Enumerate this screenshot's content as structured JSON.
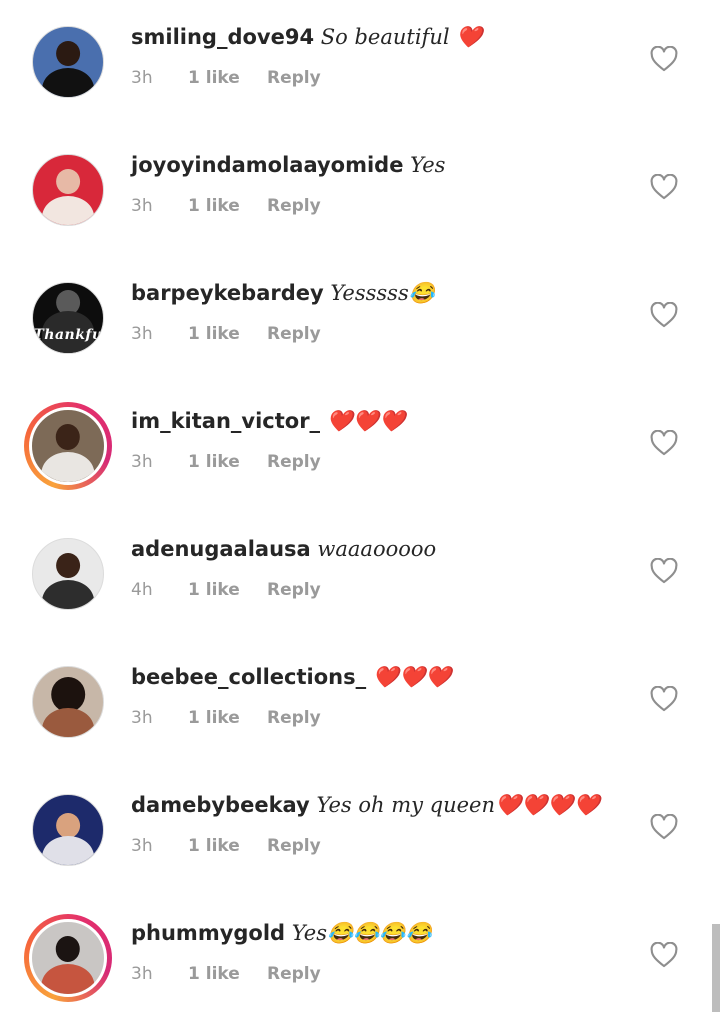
{
  "comments": [
    {
      "username": "smiling_dove94",
      "text": "So beautiful ❤️",
      "time": "3h",
      "likes": "1 like",
      "reply": "Reply",
      "avatar": {
        "bg": "#4a6fae",
        "head": "#2b1a12",
        "body": "#111111",
        "ring": false
      }
    },
    {
      "username": "joyoyindamolaayomide",
      "text": "Yes",
      "time": "3h",
      "likes": "1 like",
      "reply": "Reply",
      "avatar": {
        "bg": "#d8283a",
        "head": "#e7b9a6",
        "body": "#f2e6e0",
        "ring": false
      }
    },
    {
      "username": "barpeykebardey",
      "text": "Yesssss😂",
      "time": "3h",
      "likes": "1 like",
      "reply": "Reply",
      "avatar": {
        "bg": "#0d0d0d",
        "head": "#5a5a5a",
        "body": "#2a2a2a",
        "ring": false,
        "badge": "Thankfu"
      }
    },
    {
      "username": "im_kitan_victor_",
      "text": "❤️❤️❤️",
      "time": "3h",
      "likes": "1 like",
      "reply": "Reply",
      "avatar": {
        "bg": "#7d6a57",
        "head": "#3b2418",
        "body": "#e9e6e2",
        "ring": true
      }
    },
    {
      "username": "adenugaalausa",
      "text": "waaaooooo",
      "time": "4h",
      "likes": "1 like",
      "reply": "Reply",
      "avatar": {
        "bg": "#e9e9e9",
        "head": "#3a2318",
        "body": "#2d2d2d",
        "ring": false
      }
    },
    {
      "username": "beebee_collections_",
      "text": "❤️❤️❤️",
      "time": "3h",
      "likes": "1 like",
      "reply": "Reply",
      "avatar": {
        "bg": "#c7b7a8",
        "head": "#1c120e",
        "body": "#9a5a3e",
        "ring": false
      }
    },
    {
      "username": "damebybeekay",
      "text": "Yes oh my queen❤️❤️❤️❤️",
      "time": "3h",
      "likes": "1 like",
      "reply": "Reply",
      "avatar": {
        "bg": "#1d2a6b",
        "head": "#0f0f2a",
        "body": "#d9a27e",
        "ring": false
      }
    },
    {
      "username": "phummygold",
      "text": "Yes😂😂😂😂",
      "time": "3h",
      "likes": "1 like",
      "reply": "Reply",
      "avatar": {
        "bg": "#c9c6c4",
        "head": "#1b1412",
        "body": "#c6553f",
        "ring": true
      }
    }
  ],
  "colors": {
    "text": "#262626",
    "meta": "#9a9a9a",
    "heart_outline": "#8e8e8e"
  },
  "icons": {
    "like": "heart-outline-icon"
  }
}
